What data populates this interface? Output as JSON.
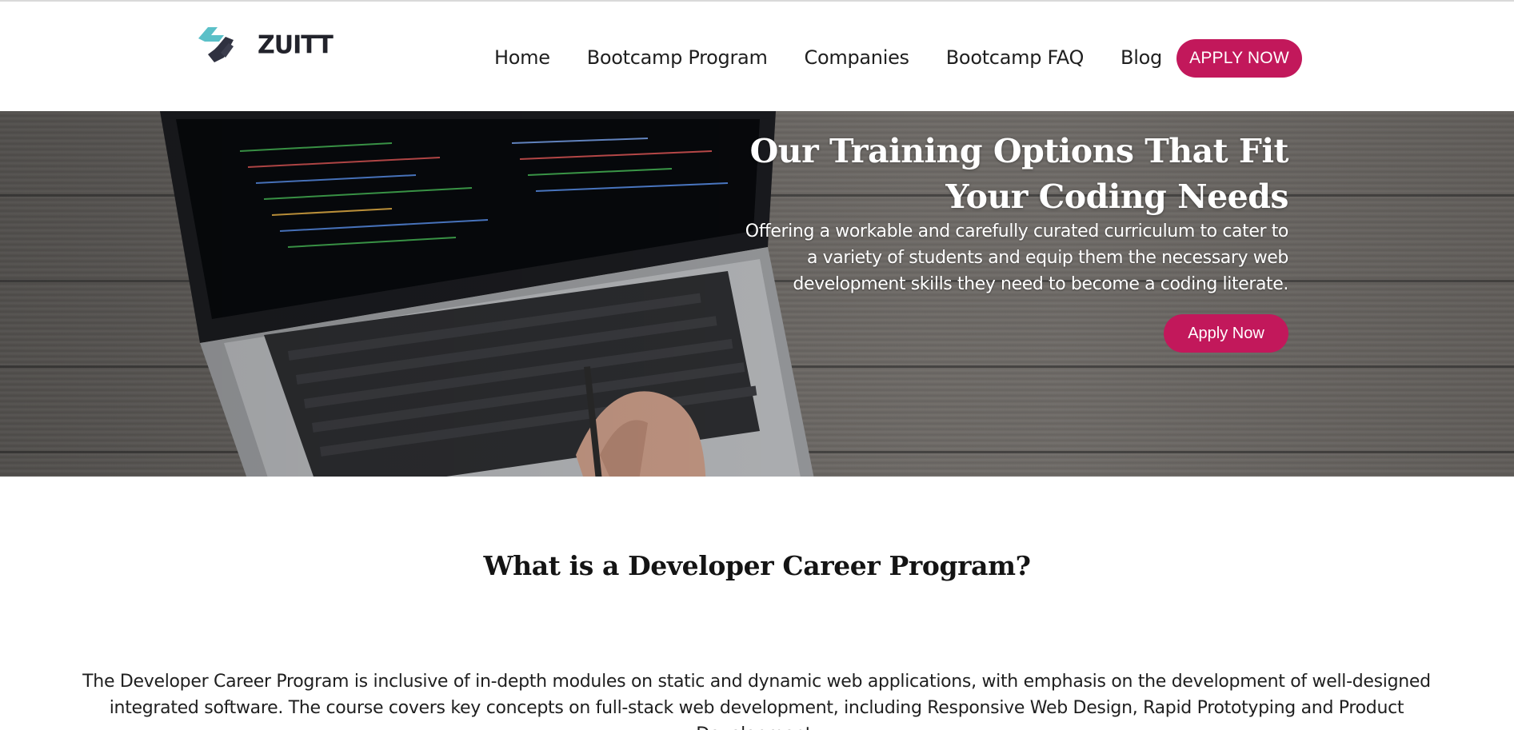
{
  "brand": {
    "name": "ZUITT",
    "accent": "#c2185b",
    "logo_teal": "#5bc0c8"
  },
  "nav": {
    "items": [
      {
        "label": "Home"
      },
      {
        "label": "Bootcamp Program"
      },
      {
        "label": "Companies"
      },
      {
        "label": "Bootcamp FAQ"
      },
      {
        "label": "Blog"
      }
    ],
    "cta": "APPLY NOW"
  },
  "hero": {
    "title_line1": "Our Training Options That Fit",
    "title_line2": "Your Coding Needs",
    "subtitle": "Offering a workable and carefully curated curriculum to cater to a variety of students and equip them the necessary web development skills they need to become a coding literate.",
    "cta": "Apply Now"
  },
  "section": {
    "title": "What is a Developer Career Program?",
    "body": "The Developer Career Program is inclusive of in-depth modules on static and dynamic web applications, with emphasis on the development of well-designed integrated software. The course covers key concepts on full-stack web development, including Responsive Web Design, Rapid Prototyping and Product Development."
  }
}
